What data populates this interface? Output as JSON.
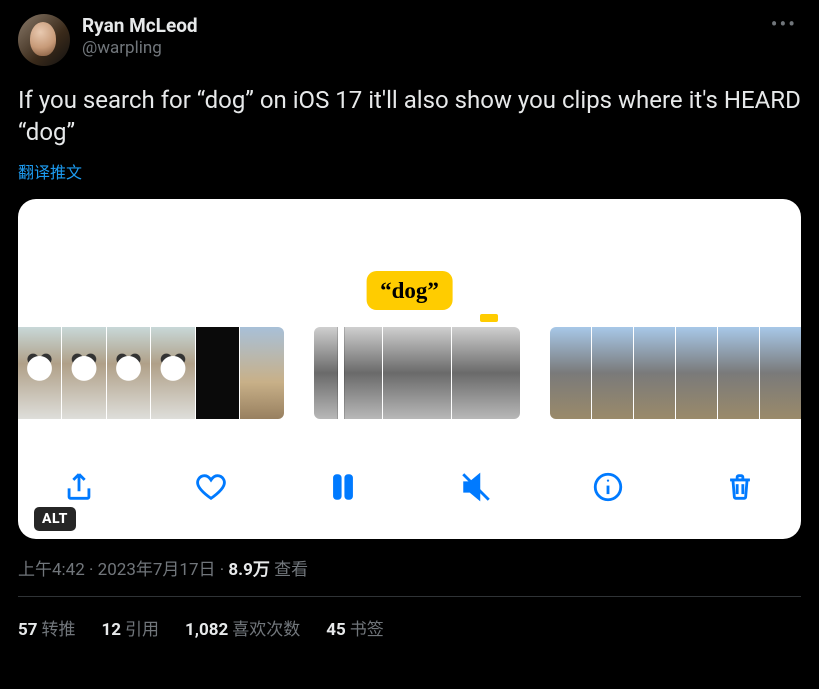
{
  "author": {
    "display_name": "Ryan McLeod",
    "handle": "@warpling"
  },
  "tweet": {
    "text": "If you search for “dog” on iOS 17 it'll also show you clips where it's HEARD “dog”",
    "translate_label": "翻译推文"
  },
  "media": {
    "tooltip_text": "“dog”",
    "alt_badge": "ALT",
    "icons": {
      "share": "share-icon",
      "heart": "heart-icon",
      "pause": "pause-icon",
      "mute": "speaker-mute-icon",
      "info": "info-icon",
      "trash": "trash-icon"
    }
  },
  "meta": {
    "time": "上午4:42",
    "sep": " · ",
    "date": "2023年7月17日",
    "views_number": "8.9万",
    "views_label": " 查看"
  },
  "stats": {
    "retweets": {
      "count": "57",
      "label": "转推"
    },
    "quotes": {
      "count": "12",
      "label": "引用"
    },
    "likes": {
      "count": "1,082",
      "label": "喜欢次数"
    },
    "bookmarks": {
      "count": "45",
      "label": "书签"
    }
  },
  "more_label": "•••"
}
